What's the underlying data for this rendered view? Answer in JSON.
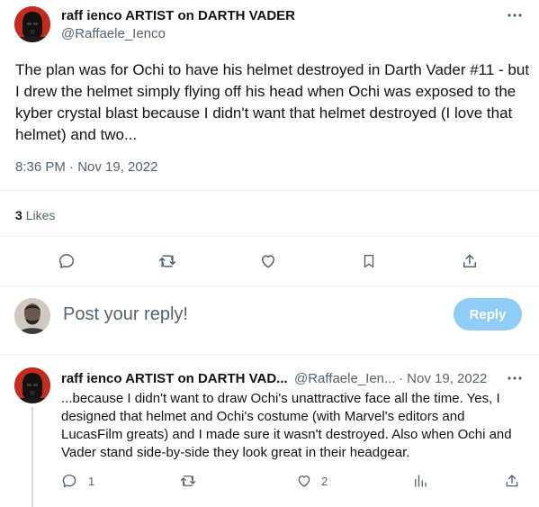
{
  "colors": {
    "accent": "#1d9bf0",
    "reply_button": "#8ecdf8",
    "muted": "#536471",
    "divider": "#eff3f4"
  },
  "main_tweet": {
    "author_name": "raff ienco ARTIST on DARTH VADER",
    "handle": "@Raffaele_Ienco",
    "text": "The plan was for Ochi to have his helmet destroyed in Darth Vader #11 - but I drew the helmet simply flying off his head when Ochi was exposed to the kyber crystal blast because I didn't want that helmet destroyed (I love that helmet) and two...",
    "timestamp": "8:36 PM · Nov 19, 2022",
    "likes_count": "3",
    "likes_label": "Likes",
    "actions": [
      "reply-icon",
      "retweet-icon",
      "like-icon",
      "bookmark-icon",
      "share-icon"
    ]
  },
  "composer": {
    "placeholder": "Post your reply!",
    "button_label": "Reply"
  },
  "reply_tweet": {
    "author_name": "raff ienco ARTIST on DARTH VAD...",
    "handle": "@Raffaele_Ien...",
    "date": "· Nov 19, 2022",
    "text": "...because I didn't want to draw Ochi's unattractive face all the time. Yes, I designed that helmet and Ochi's costume (with Marvel's editors and LucasFilm greats) and I made sure it wasn't destroyed. Also when Ochi and Vader stand side-by-side they look great in their headgear.",
    "reply_count": "1",
    "retweet_count": "",
    "like_count": "2"
  }
}
